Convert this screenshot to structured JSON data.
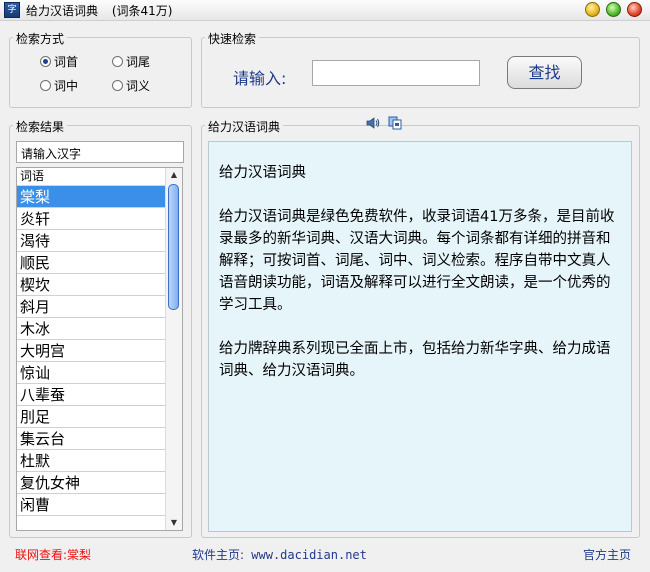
{
  "window": {
    "title": "给力汉语词典",
    "count": "(词条41万)"
  },
  "search_mode": {
    "legend": "检索方式",
    "options": [
      {
        "label": "词首",
        "selected": true
      },
      {
        "label": "词尾",
        "selected": false
      },
      {
        "label": "词中",
        "selected": false
      },
      {
        "label": "词义",
        "selected": false
      }
    ]
  },
  "quick_search": {
    "legend": "快速检索",
    "input_label": "请输入:",
    "input_value": "",
    "button_label": "查找"
  },
  "results": {
    "legend": "检索结果",
    "filter_value": "请输入汉字",
    "column_header": "词语",
    "items": [
      "棠梨",
      "炎轩",
      "渴待",
      "顺民",
      "楔坎",
      "斜月",
      "木冰",
      "大明宫",
      "惊讪",
      "八辈蚕",
      "刖足",
      "集云台",
      "杜默",
      "复仇女神",
      "闲曹"
    ],
    "selected_index": 0
  },
  "dictionary": {
    "legend": "给力汉语词典",
    "heading": "给力汉语词典",
    "paragraph1": "给力汉语词典是绿色免费软件，收录词语41万多条，是目前收录最多的新华词典、汉语大词典。每个词条都有详细的拼音和解释；可按词首、词尾、词中、词义检索。程序自带中文真人语音朗读功能，词语及解释可以进行全文朗读，是一个优秀的学习工具。",
    "paragraph2": "给力牌辞典系列现已全面上市，包括给力新华字典、给力成语词典、给力汉语词典。",
    "icons": [
      "speaker-icon",
      "copy-icon"
    ]
  },
  "status_bar": {
    "online_lookup": "联网查看:棠梨",
    "homepage_label": "软件主页:",
    "homepage_url": "www.dacidian.net",
    "official_link": "官方主页"
  },
  "colors": {
    "accent_blue": "#1f3a8a",
    "selection": "#3b8fe8",
    "panel_bg": "#e6f5fa",
    "link_red": "#e11111"
  }
}
